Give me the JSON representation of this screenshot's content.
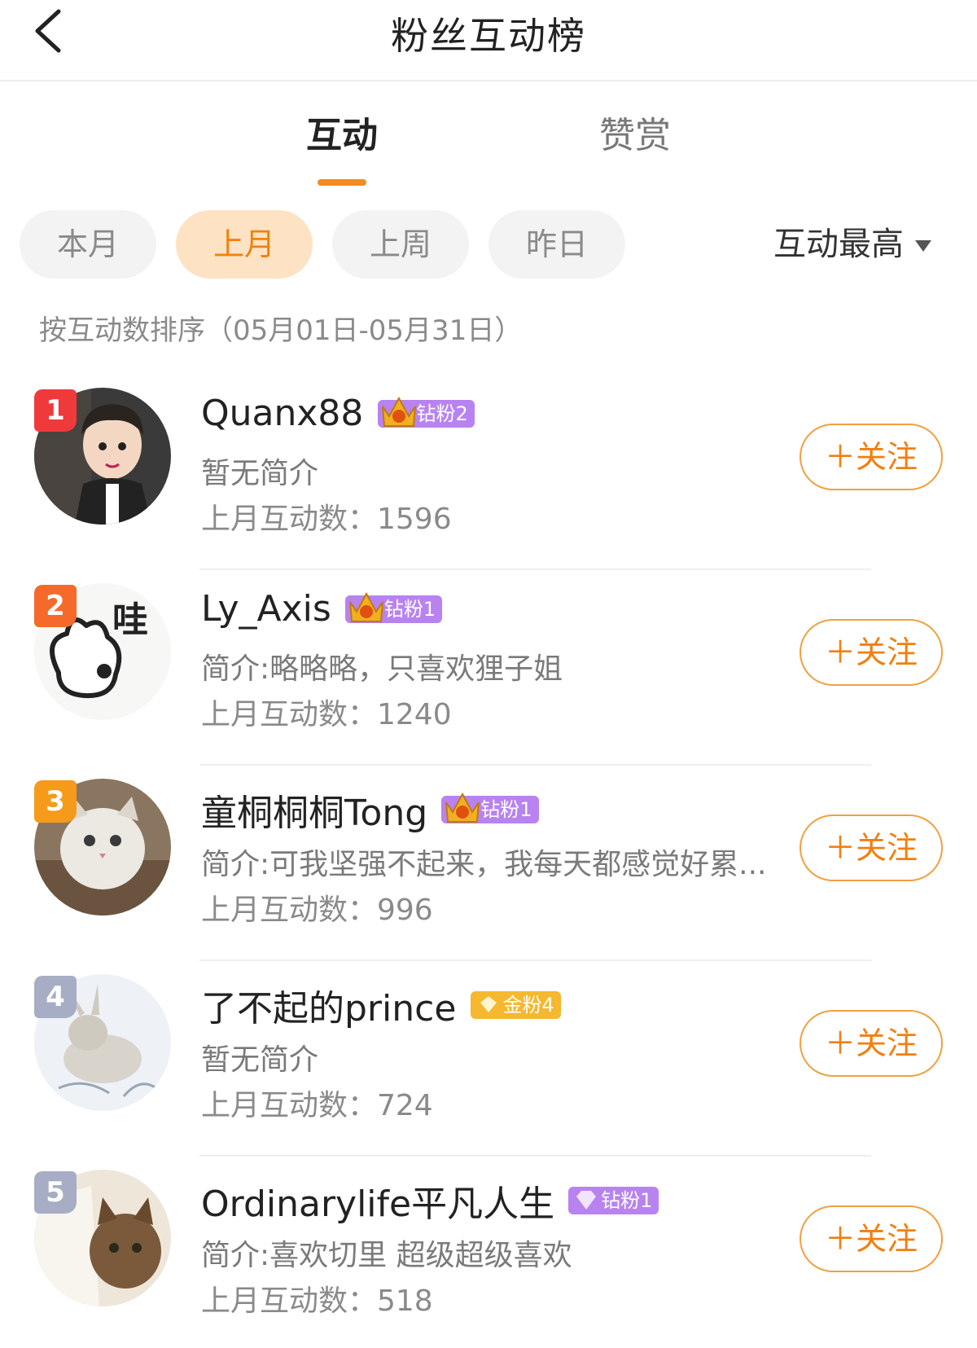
{
  "header": {
    "title": "粉丝互动榜"
  },
  "tabs": [
    {
      "label": "互动",
      "active": true
    },
    {
      "label": "赞赏",
      "active": false
    }
  ],
  "filters": {
    "periods": [
      {
        "label": "本月",
        "active": false
      },
      {
        "label": "上月",
        "active": true
      },
      {
        "label": "上周",
        "active": false
      },
      {
        "label": "昨日",
        "active": false
      }
    ],
    "sort_label": "互动最高"
  },
  "sort_caption": "按互动数排序（05月01日-05月31日）",
  "follow_label": "＋关注",
  "fans": [
    {
      "rank": "1",
      "name": "Quanx88",
      "badge": "钻粉2",
      "badge_level": "9",
      "bio": "暂无简介",
      "count": "上月互动数：1596"
    },
    {
      "rank": "2",
      "name": "Ly_Axis",
      "badge": "钻粉1",
      "badge_level": "4",
      "bio": "简介:略略略，只喜欢狸子姐",
      "count": "上月互动数：1240"
    },
    {
      "rank": "3",
      "name": "童桐桐桐Tong",
      "badge": "钻粉1",
      "badge_level": "",
      "bio": "简介:可我坚强不起来，我每天都感觉好累...",
      "count": "上月互动数：996"
    },
    {
      "rank": "4",
      "name": "了不起的prince",
      "badge": "金粉4",
      "badge_level": "",
      "bio": "暂无简介",
      "count": "上月互动数：724"
    },
    {
      "rank": "5",
      "name": "Ordinarylife平凡人生",
      "badge": "钻粉1",
      "badge_level": "",
      "bio": "简介:喜欢切里 超级超级喜欢",
      "count": "上月互动数：518"
    }
  ],
  "colors": {
    "accent": "#f58a1f",
    "rank1": "#f0393a",
    "rank2": "#f56a2a",
    "rank3": "#f59a1a",
    "rank_other": "#a7adc4",
    "badge_diamond": "#b883f0",
    "badge_gold": "#f5b82e"
  }
}
